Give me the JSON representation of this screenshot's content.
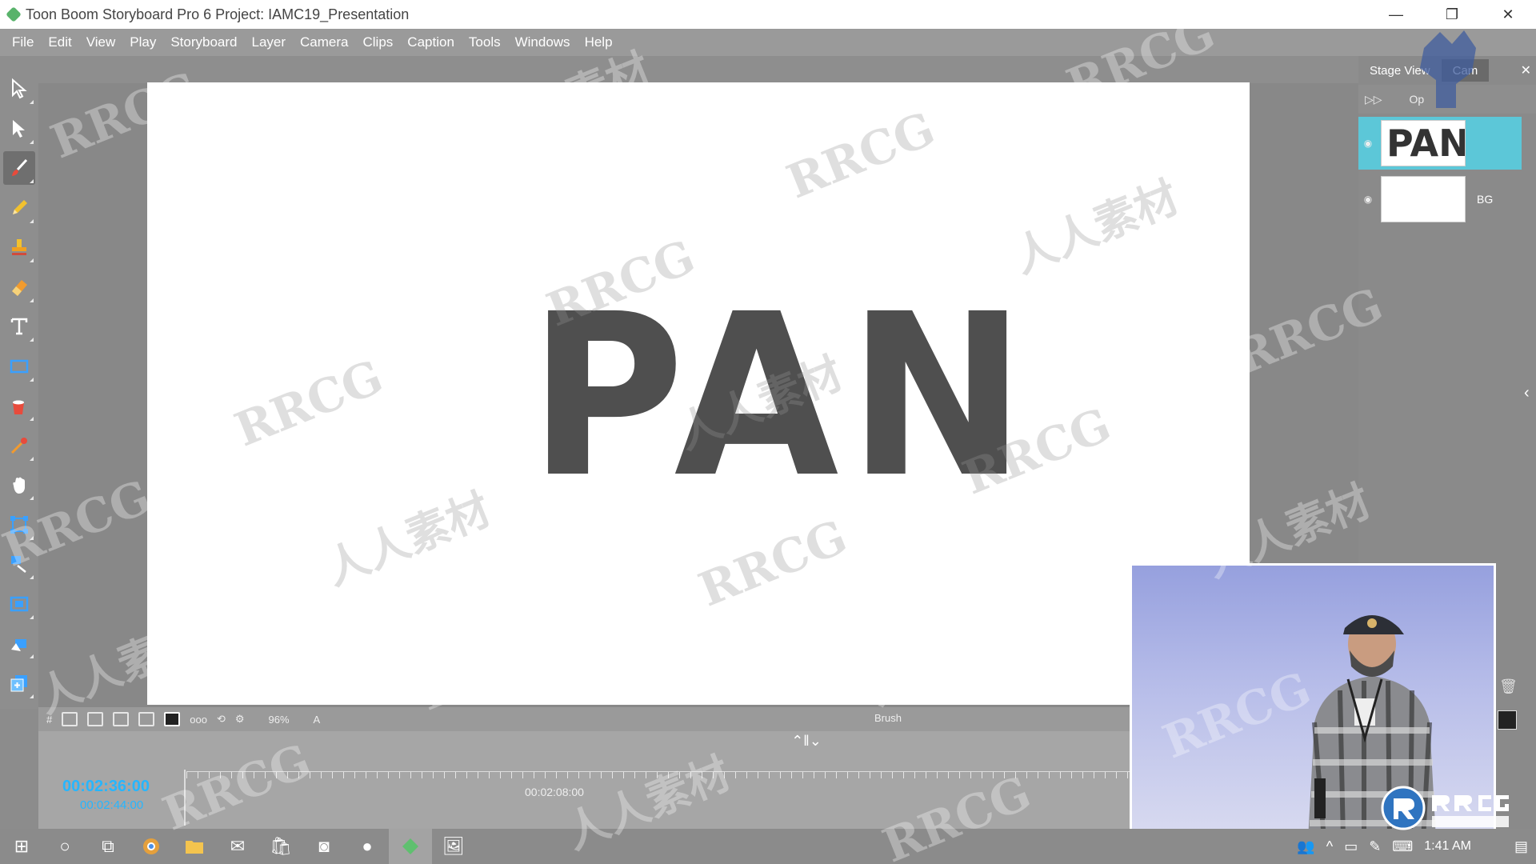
{
  "window": {
    "title": "Toon Boom Storyboard Pro 6 Project: IAMC19_Presentation",
    "controls": {
      "minimize": "—",
      "restore": "❐",
      "close": "✕"
    }
  },
  "menu": [
    "File",
    "Edit",
    "View",
    "Play",
    "Storyboard",
    "Layer",
    "Camera",
    "Clips",
    "Caption",
    "Tools",
    "Windows",
    "Help"
  ],
  "tools": [
    {
      "name": "select-tool-icon"
    },
    {
      "name": "transform-tool-icon"
    },
    {
      "name": "brush-tool-icon",
      "active": true
    },
    {
      "name": "pencil-tool-icon"
    },
    {
      "name": "stamp-tool-icon"
    },
    {
      "name": "eraser-tool-icon"
    },
    {
      "name": "text-tool-icon"
    },
    {
      "name": "rectangle-tool-icon"
    },
    {
      "name": "paint-bucket-icon"
    },
    {
      "name": "dropper-tool-icon"
    },
    {
      "name": "hand-tool-icon"
    },
    {
      "name": "bounding-box-icon"
    },
    {
      "name": "layer-transform-icon"
    },
    {
      "name": "camera-frame-icon"
    },
    {
      "name": "motion-icon"
    },
    {
      "name": "add-panel-icon"
    }
  ],
  "canvas": {
    "drawing_text": "PAN"
  },
  "stage_toolbar": {
    "zoom": "96%",
    "mode": "A",
    "tool_label": "Brush"
  },
  "right_panel": {
    "tabs": [
      "Stage View",
      "Cam"
    ],
    "layers_header": "Op",
    "layers": [
      {
        "thumb": "PAN",
        "name": "",
        "selected": true
      },
      {
        "thumb": "",
        "name": "BG",
        "selected": false
      }
    ]
  },
  "timeline": {
    "current_time": "00:02:36:00",
    "total_time": "00:02:44:00",
    "marker_time": "00:02:08:00",
    "nav": "⌃‖⌄"
  },
  "taskbar": {
    "icons": [
      "windows-start-icon",
      "cortana-icon",
      "task-view-icon",
      "chrome-icon",
      "file-explorer-icon",
      "mail-icon",
      "store-icon",
      "app-icon",
      "app-circle-icon",
      "storyboard-pro-icon",
      "photos-icon"
    ],
    "clock": "1:41 AM"
  },
  "watermarks": {
    "rrcg": "RRCG",
    "cn": "人人素材"
  }
}
